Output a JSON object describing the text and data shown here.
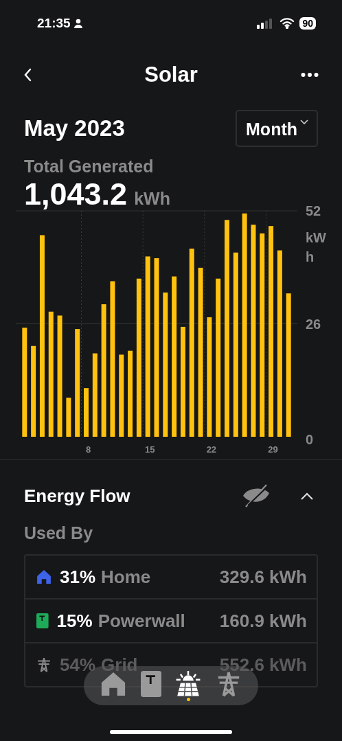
{
  "status_bar": {
    "time": "21:35",
    "battery": "90"
  },
  "nav": {
    "title": "Solar"
  },
  "header": {
    "period": "May 2023",
    "range_button": "Month"
  },
  "summary": {
    "label": "Total Generated",
    "value": "1,043.2",
    "unit": "kWh"
  },
  "chart": {
    "chart_data": {
      "type": "bar",
      "ylabel": "kWh",
      "grid": true,
      "x": [
        1,
        2,
        3,
        4,
        5,
        6,
        7,
        8,
        9,
        10,
        11,
        12,
        13,
        14,
        15,
        16,
        17,
        18,
        19,
        20,
        21,
        22,
        23,
        24,
        25,
        26,
        27,
        28,
        29,
        30,
        31
      ],
      "series": [
        {
          "color": "#ffc20e",
          "values": [
            25.1,
            20.9,
            46.4,
            28.8,
            27.9,
            9.0,
            24.8,
            11.2,
            19.2,
            30.5,
            35.8,
            18.9,
            19.8,
            36.4,
            41.5,
            41.1,
            33.2,
            36.9,
            25.3,
            43.3,
            38.9,
            27.5,
            36.4,
            49.9,
            42.4,
            51.4,
            48.8,
            46.8,
            48.5,
            42.9,
            33.0
          ]
        }
      ],
      "xticks": [
        8,
        15,
        22,
        29
      ],
      "xlim": [
        0,
        32
      ],
      "ylim": [
        0,
        52
      ],
      "yticks": [
        0,
        26,
        52
      ]
    }
  },
  "energy_flow": {
    "title": "Energy Flow",
    "expanded": true,
    "subtitle": "Used By",
    "rows": [
      {
        "kind": "home",
        "color": "#3d63e8",
        "percent": "31%",
        "name": "Home",
        "amount": "329.6 kWh"
      },
      {
        "kind": "powerwall",
        "color": "#1faa59",
        "percent": "15%",
        "name": "Powerwall",
        "amount": "160.9 kWh"
      },
      {
        "kind": "grid",
        "color": "#8a8a8a",
        "percent": "54%",
        "name": "Grid",
        "amount": "552.6 kWh"
      }
    ]
  },
  "tab_bar": [
    {
      "kind": "home",
      "selected": false
    },
    {
      "kind": "powerwall",
      "selected": false
    },
    {
      "kind": "solar",
      "selected": true
    },
    {
      "kind": "grid",
      "selected": false
    }
  ]
}
